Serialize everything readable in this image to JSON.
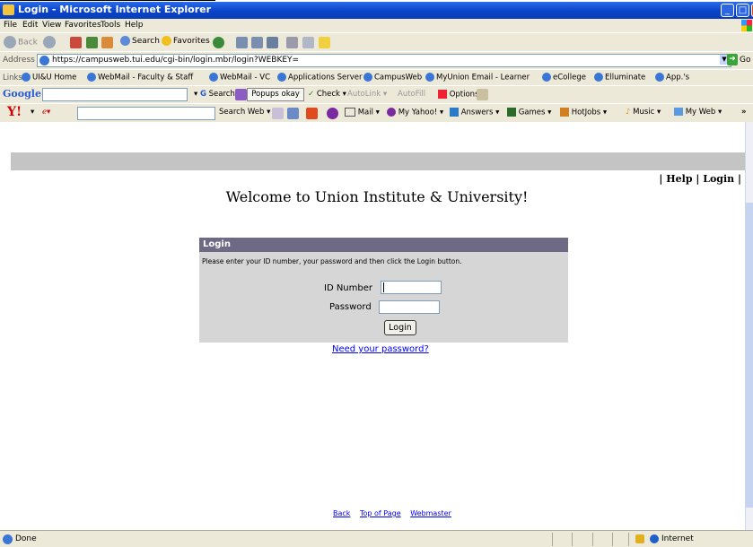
{
  "window": {
    "title": "Login - Microsoft Internet Explorer"
  },
  "menu": [
    "File",
    "Edit",
    "View",
    "Favorites",
    "Tools",
    "Help"
  ],
  "toolbar": {
    "back": "Back",
    "search": "Search",
    "favorites": "Favorites"
  },
  "address": {
    "label": "Address",
    "url": "https://campusweb.tui.edu/cgi-bin/login.mbr/login?WEBKEY=",
    "go": "Go"
  },
  "links": {
    "label": "Links",
    "items": [
      "UI&U Home",
      "WebMail - Faculty & Staff",
      "WebMail - VC",
      "Applications Server",
      "CampusWeb",
      "MyUnion Email - Learner",
      "eCollege",
      "Elluminate",
      "App.'s"
    ]
  },
  "google": {
    "logo": "Google",
    "search": "Search",
    "popups": "Popups okay",
    "check": "Check",
    "autolink": "AutoLink",
    "autofill": "AutoFill",
    "options": "Options"
  },
  "yahoo": {
    "logo": "Y!",
    "search": "Search Web",
    "mail": "Mail",
    "myyahoo": "My Yahoo!",
    "answers": "Answers",
    "games": "Games",
    "hotjobs": "HotJobs",
    "music": "Music",
    "myweb": "My Web"
  },
  "page": {
    "help": "Help",
    "login_link": "Login",
    "welcome": "Welcome to Union Institute & University!",
    "login_box_title": "Login",
    "instructions": "Please enter your ID number, your password and then click the Login button.",
    "id_label": "ID Number",
    "password_label": "Password",
    "login_button": "Login",
    "need_password": "Need your password?",
    "footer": [
      "Back",
      "Top of Page",
      "Webmaster"
    ]
  },
  "status": {
    "text": "Done",
    "zone": "Internet"
  }
}
